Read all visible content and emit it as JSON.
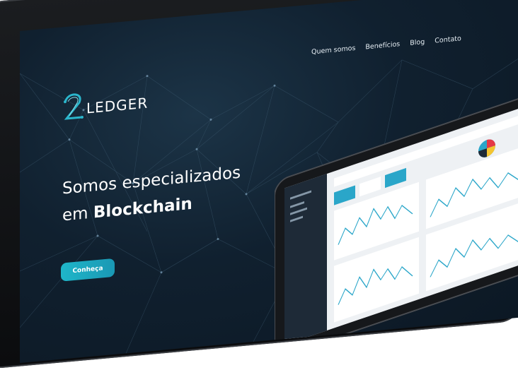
{
  "brand": {
    "logo_mark": "2",
    "name": "LEDGER"
  },
  "nav": {
    "items": [
      "Quem somos",
      "Benefícios",
      "Blog",
      "Contato"
    ]
  },
  "hero": {
    "line1": "Somos especializados",
    "line2_prefix": "em ",
    "line2_bold": "Blockchain"
  },
  "cta": {
    "label": "Conheça"
  },
  "colors": {
    "accent": "#1fb6c9",
    "screen_bg": "#10202f",
    "text": "#ffffff"
  },
  "icons": [
    "camera-icon",
    "logo-2-icon",
    "tablet-mockup-image",
    "pie-chart-icon"
  ]
}
